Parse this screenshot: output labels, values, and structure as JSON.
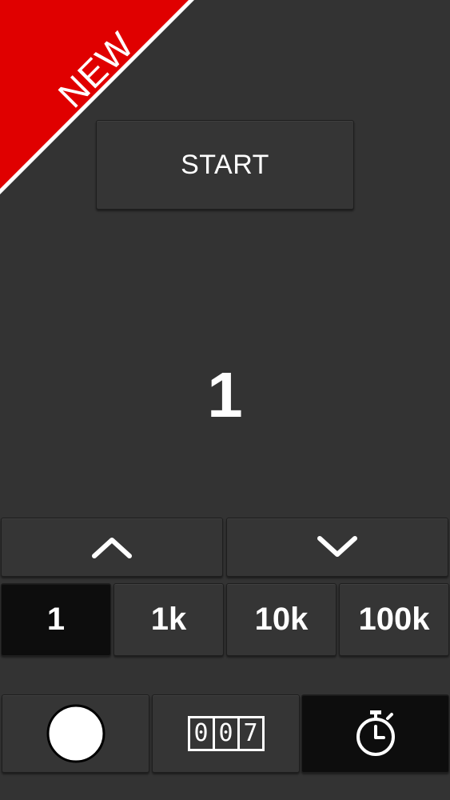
{
  "ribbon": {
    "label": "NEW",
    "color": "#e00000"
  },
  "start": {
    "label": "START"
  },
  "counter": {
    "value": "1"
  },
  "arrows": {
    "up_icon": "chevron-up-icon",
    "down_icon": "chevron-down-icon"
  },
  "steps": [
    {
      "label": "1",
      "selected": true
    },
    {
      "label": "1k",
      "selected": false
    },
    {
      "label": "10k",
      "selected": false
    },
    {
      "label": "100k",
      "selected": false
    }
  ],
  "modes": [
    {
      "icon": "circle-icon",
      "selected": false
    },
    {
      "icon": "digital-counter-icon",
      "digits": [
        "0",
        "0",
        "7"
      ],
      "selected": false
    },
    {
      "icon": "stopwatch-icon",
      "selected": true
    }
  ]
}
